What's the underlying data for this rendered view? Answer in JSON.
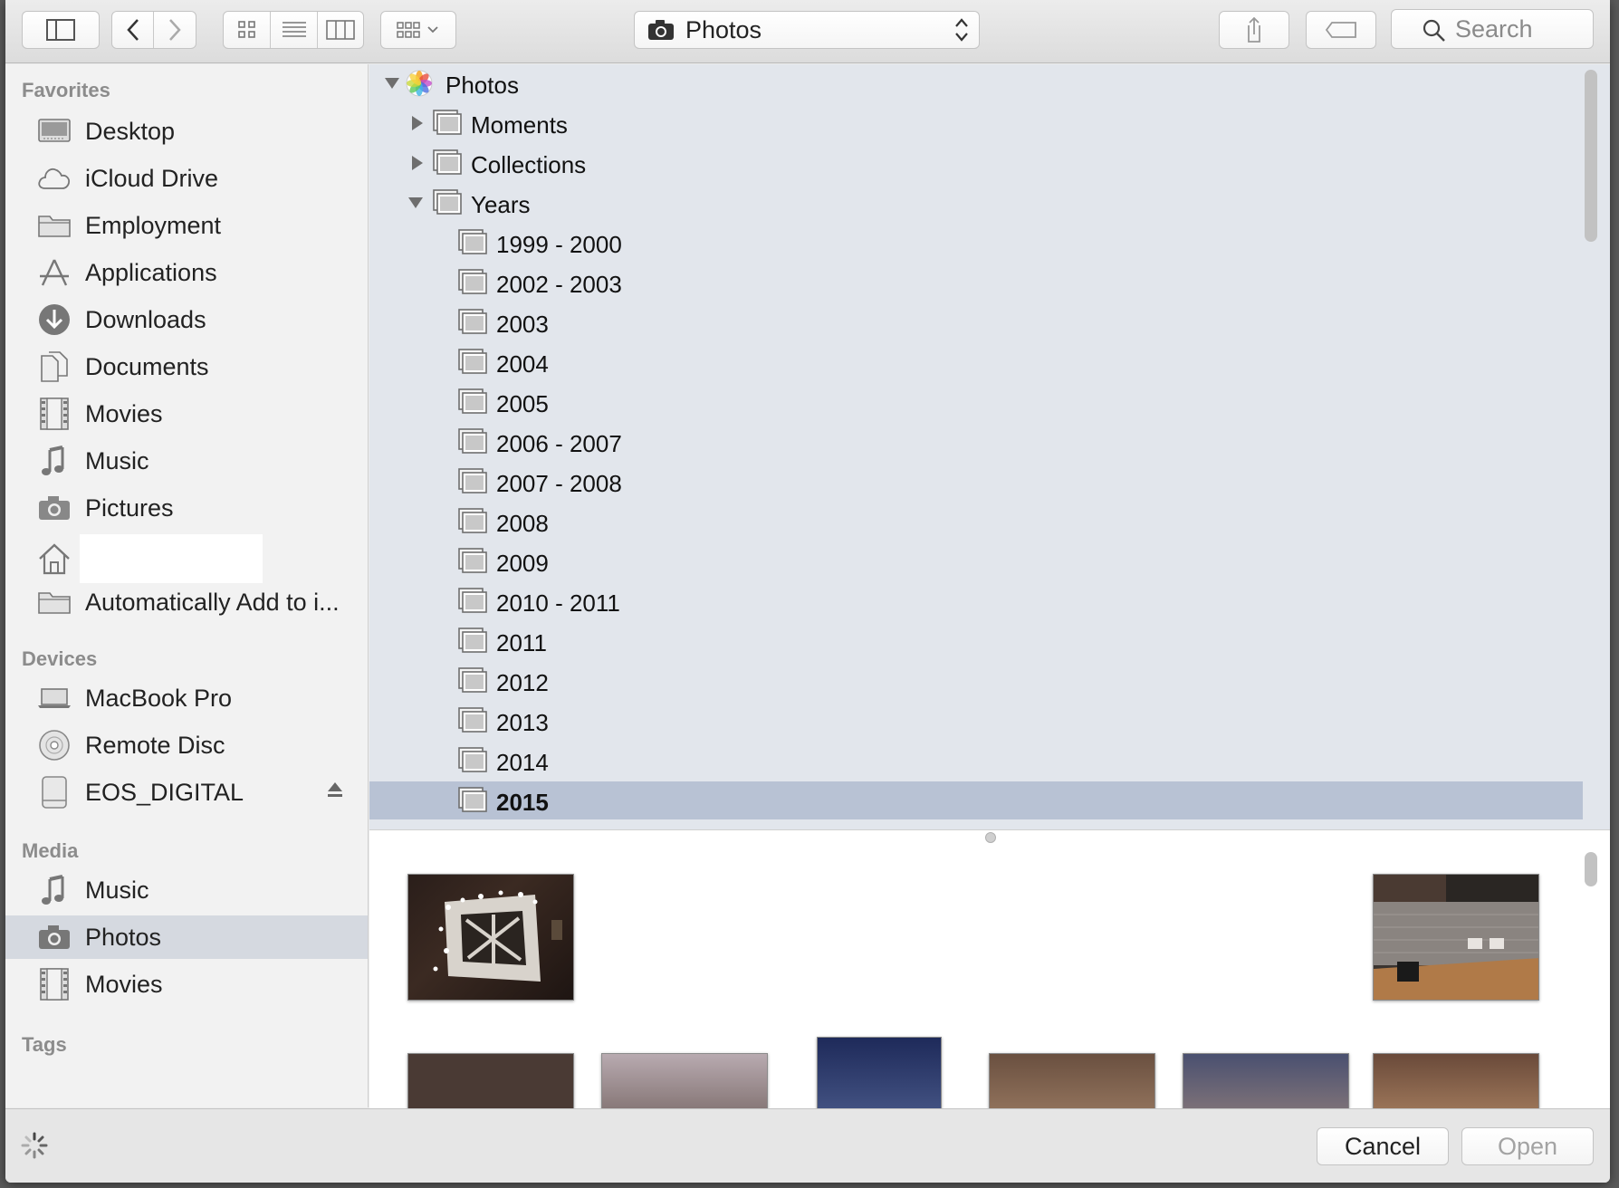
{
  "toolbar": {
    "location_label": "Photos",
    "search_placeholder": "Search"
  },
  "sidebar": {
    "favorites_header": "Favorites",
    "favorites": [
      {
        "label": "Desktop",
        "icon": "desktop-icon"
      },
      {
        "label": "iCloud Drive",
        "icon": "cloud-icon"
      },
      {
        "label": "Employment",
        "icon": "folder-icon"
      },
      {
        "label": "Applications",
        "icon": "applications-icon"
      },
      {
        "label": "Downloads",
        "icon": "download-icon"
      },
      {
        "label": "Documents",
        "icon": "documents-icon"
      },
      {
        "label": "Movies",
        "icon": "film-icon"
      },
      {
        "label": "Music",
        "icon": "music-note-icon"
      },
      {
        "label": "Pictures",
        "icon": "camera-icon"
      },
      {
        "label": "",
        "icon": "home-icon"
      },
      {
        "label": "Automatically Add to i...",
        "icon": "folder-icon"
      }
    ],
    "devices_header": "Devices",
    "devices": [
      {
        "label": "MacBook Pro",
        "icon": "laptop-icon"
      },
      {
        "label": "Remote Disc",
        "icon": "disc-icon"
      },
      {
        "label": "EOS_DIGITAL",
        "icon": "drive-icon"
      }
    ],
    "media_header": "Media",
    "media": [
      {
        "label": "Music",
        "icon": "music-note-icon"
      },
      {
        "label": "Photos",
        "icon": "camera-icon",
        "selected": true
      },
      {
        "label": "Movies",
        "icon": "film-icon"
      }
    ],
    "tags_header": "Tags"
  },
  "browser": {
    "root": "Photos",
    "groups": [
      {
        "label": "Moments",
        "expanded": false
      },
      {
        "label": "Collections",
        "expanded": false
      },
      {
        "label": "Years",
        "expanded": true
      }
    ],
    "years": [
      "1999 - 2000",
      "2002 - 2003",
      "2003",
      "2004",
      "2005",
      "2006 - 2007",
      "2007 - 2008",
      "2008",
      "2009",
      "2010 - 2011",
      "2011",
      "2012",
      "2013",
      "2014",
      "2015"
    ],
    "selected_year": "2015"
  },
  "footer": {
    "cancel_label": "Cancel",
    "open_label": "Open"
  },
  "colors": {
    "selection": "#b8c2d4",
    "sidebar_selection": "#d5d9e0",
    "browser_bg": "#e2e6ec"
  }
}
